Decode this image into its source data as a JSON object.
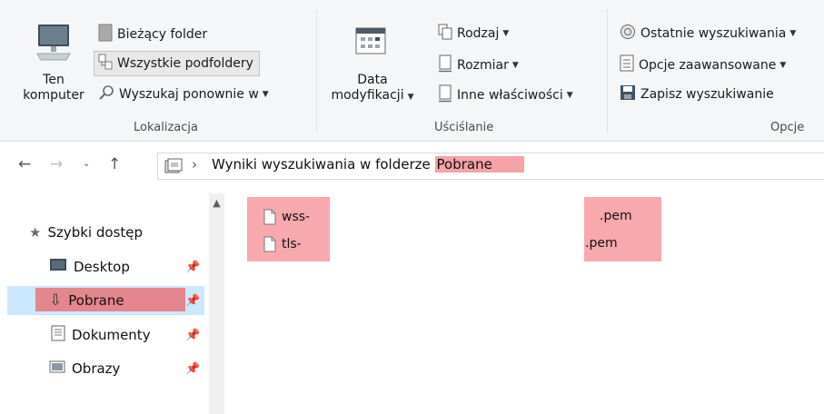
{
  "ribbon": {
    "lokalizacja": {
      "ten_komputer_line1": "Ten",
      "ten_komputer_line2": "komputer",
      "biezacy_folder": "Bieżący folder",
      "wszystkie_podfoldery": "Wszystkie podfoldery",
      "wyszukaj_ponownie": "Wyszukaj ponownie w",
      "group_label": "Lokalizacja"
    },
    "uscislanie": {
      "data_line1": "Data",
      "data_line2": "modyfikacji",
      "rodzaj": "Rodzaj",
      "rozmiar": "Rozmiar",
      "inne": "Inne właściwości",
      "group_label": "Uściślanie"
    },
    "opcje": {
      "ostatnie": "Ostatnie wyszukiwania",
      "zaawansowane": "Opcje zaawansowane",
      "zapisz": "Zapisz wyszukiwanie",
      "group_label": "Opcje"
    }
  },
  "address": {
    "separator": "›",
    "text": "Wyniki wyszukiwania w folderze",
    "folder": "Pobrane"
  },
  "nav": {
    "quick_access": "Szybki dostęp",
    "items": [
      {
        "label": "Desktop"
      },
      {
        "label": "Pobrane"
      },
      {
        "label": "Dokumenty"
      },
      {
        "label": "Obrazy"
      }
    ]
  },
  "files": [
    {
      "name": "wss-",
      "ext": ".pem"
    },
    {
      "name": "tls-",
      "ext": ".pem"
    }
  ],
  "colors": {
    "highlight": "#f4a3a8",
    "selection": "#cce8ff"
  }
}
